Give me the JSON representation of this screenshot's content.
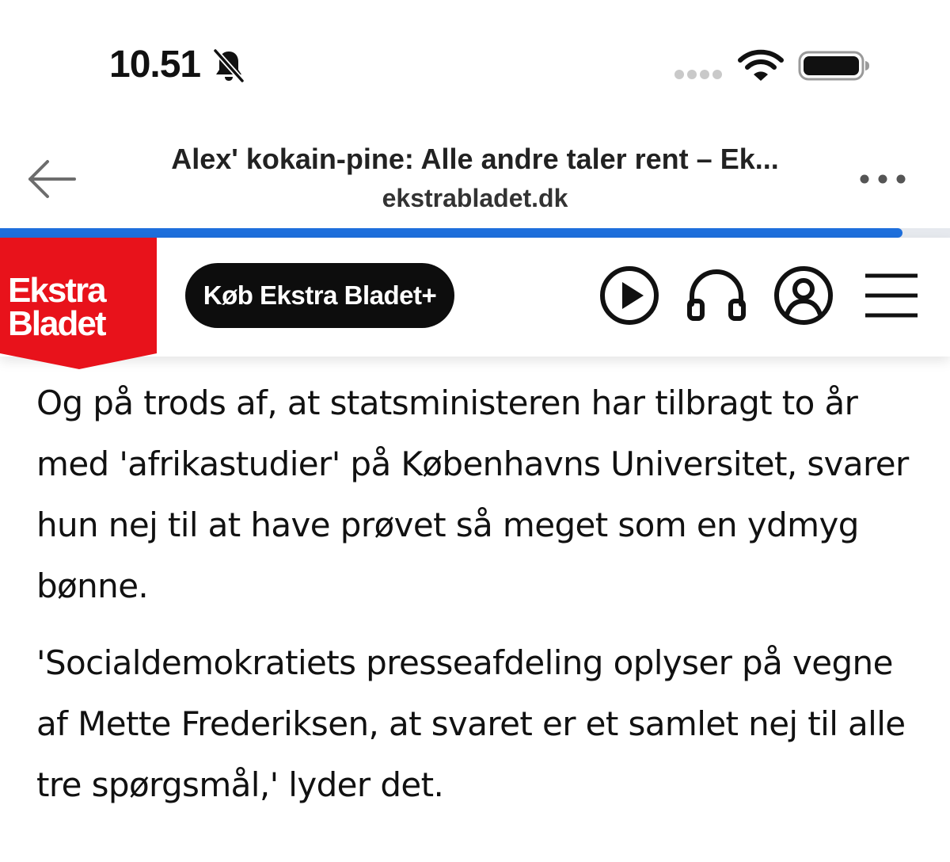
{
  "status_bar": {
    "time": "10.51",
    "icons": [
      "bell-slash-icon",
      "signal-dots-icon",
      "wifi-icon",
      "battery-icon"
    ]
  },
  "browser": {
    "title": "Alex' kokain-pine: Alle andre taler rent – Ek...",
    "domain": "ekstrabladet.dk",
    "load_progress": 0.95,
    "colors": {
      "progress": "#1e6fdc",
      "track": "#e6e9ee"
    }
  },
  "site_nav": {
    "logo": {
      "line1": "Ekstra",
      "line2": "Bladet",
      "color": "#e8121b"
    },
    "buy_label": "Køb Ekstra Bladet+",
    "icons": [
      "play-icon",
      "headphones-icon",
      "user-icon",
      "menu-icon"
    ]
  },
  "article": {
    "paragraphs": [
      "Og på trods af, at statsministeren har tilbragt to år med 'afrikastudier' på Københavns Universitet, svarer hun nej til at have prøvet så meget som en ydmyg bønne.",
      "'Socialdemokratiets presseafdeling oplyser på vegne af Mette Frederiksen, at svaret er et samlet nej til alle tre spørgsmål,' lyder det."
    ]
  }
}
